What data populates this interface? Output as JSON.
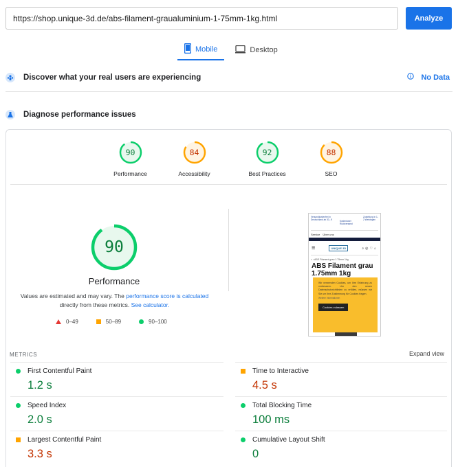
{
  "url": "https://shop.unique-3d.de/abs-filament-graualuminium-1-75mm-1kg.html",
  "analyze_label": "Analyze",
  "tabs": {
    "mobile": "Mobile",
    "desktop": "Desktop"
  },
  "field_data": {
    "title": "Discover what your real users are experiencing",
    "no_data": "No Data"
  },
  "diagnose": {
    "title": "Diagnose performance issues"
  },
  "categories": [
    {
      "score": "90",
      "label": "Performance",
      "rating": "pass"
    },
    {
      "score": "84",
      "label": "Accessibility",
      "rating": "average"
    },
    {
      "score": "92",
      "label": "Best Practices",
      "rating": "pass"
    },
    {
      "score": "88",
      "label": "SEO",
      "rating": "average"
    }
  ],
  "main_score": {
    "score": "90",
    "label": "Performance"
  },
  "description": {
    "part1": "Values are estimated and may vary. The ",
    "link1": "performance score is calculated",
    "part2": " directly from these metrics. ",
    "link2": "See calculator."
  },
  "legend": [
    "0–49",
    "50–89",
    "90–100"
  ],
  "colors": {
    "pass": "#0cce6b",
    "average": "#ffa400",
    "fail": "#ff4e42",
    "accent": "#1a73e8"
  },
  "metrics": {
    "heading": "METRICS",
    "expand": "Expand view",
    "items": [
      {
        "name": "First Contentful Paint",
        "value": "1.2 s",
        "rating": "pass"
      },
      {
        "name": "Time to Interactive",
        "value": "4.5 s",
        "rating": "average"
      },
      {
        "name": "Speed Index",
        "value": "2.0 s",
        "rating": "pass"
      },
      {
        "name": "Total Blocking Time",
        "value": "100 ms",
        "rating": "pass"
      },
      {
        "name": "Largest Contentful Paint",
        "value": "3.3 s",
        "rating": "average"
      },
      {
        "name": "Cumulative Layout Shift",
        "value": "0",
        "rating": "pass"
      }
    ]
  },
  "preview": {
    "top_links": [
      "Versandkostenfrei in Deutschland ab 30,- €",
      "Kostenloser Rückversand",
      "Zustellung in 1-2 Werktagen"
    ],
    "service": "Service",
    "about": "Über uns",
    "logo": "UNIQUE 3D",
    "breadcrumb": "ABS Filament grau 1.75mm 1kg",
    "product_title": "ABS Filament grau 1.75mm 1kg",
    "cookie_text": "Wir verwenden Cookies, um Ihre Erfahrung zu verbessern. Um den neuen Datenschutzrichtlinien zu erfüllen, müssen wir Sie um Ihre Zustimmung für Cookies fragen.",
    "cookie_more": "Weitere Informationen",
    "cookie_button": "Cookies zulassen"
  }
}
